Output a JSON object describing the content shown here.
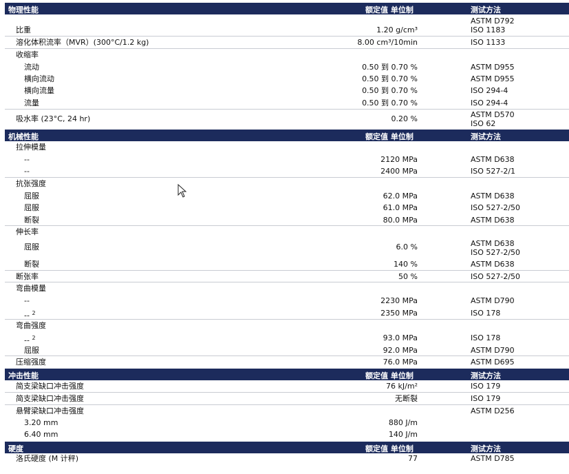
{
  "headers": {
    "value_unit": "额定值 单位制",
    "test_method": "测试方法"
  },
  "sections": [
    {
      "title": "物理性能",
      "rows": [
        {
          "label": "比重",
          "value": "1.20 g/cm³",
          "method": [
            "ASTM D792",
            "ISO 1183"
          ]
        },
        {
          "label": "溶化体积流率（MVR）(300°C/1.2 kg)",
          "value": "8.00 cm³/10min",
          "method": [
            "ISO 1133"
          ]
        },
        {
          "label": "收缩率",
          "value": "",
          "method": []
        },
        {
          "label": "流动",
          "value": "0.50 到 0.70 %",
          "method": [
            "ASTM D955"
          ]
        },
        {
          "label": "横向流动",
          "value": "0.50 到 0.70 %",
          "method": [
            "ASTM D955"
          ]
        },
        {
          "label": "横向流量",
          "value": "0.50 到 0.70 %",
          "method": [
            "ISO 294-4"
          ]
        },
        {
          "label": "流量",
          "value": "0.50 到 0.70 %",
          "method": [
            "ISO 294-4"
          ]
        },
        {
          "label": "吸水率 (23°C, 24 hr)",
          "value": "0.20 %",
          "method": [
            "ASTM D570",
            "ISO 62"
          ]
        }
      ]
    },
    {
      "title": "机械性能",
      "rows": [
        {
          "label": "拉伸模量",
          "value": "",
          "method": []
        },
        {
          "label": "--",
          "value": "2120 MPa",
          "method": [
            "ASTM D638"
          ]
        },
        {
          "label": "--",
          "value": "2400 MPa",
          "method": [
            "ISO 527-2/1"
          ]
        },
        {
          "label": "抗张强度",
          "value": "",
          "method": []
        },
        {
          "label": "屈服",
          "value": "62.0 MPa",
          "method": [
            "ASTM D638"
          ]
        },
        {
          "label": "屈服",
          "value": "61.0 MPa",
          "method": [
            "ISO 527-2/50"
          ]
        },
        {
          "label": "断裂",
          "value": "80.0 MPa",
          "method": [
            "ASTM D638"
          ]
        },
        {
          "label": "伸长率",
          "value": "",
          "method": []
        },
        {
          "label": "屈服",
          "value": "6.0 %",
          "method": [
            "ASTM D638",
            "ISO 527-2/50"
          ]
        },
        {
          "label": "断裂",
          "value": "140 %",
          "method": [
            "ASTM D638"
          ]
        },
        {
          "label": "断张率",
          "value": "50 %",
          "method": [
            "ISO 527-2/50"
          ]
        },
        {
          "label": "弯曲模量",
          "value": "",
          "method": []
        },
        {
          "label": "--",
          "value": "2230 MPa",
          "method": [
            "ASTM D790"
          ]
        },
        {
          "label": "--",
          "sup": "2",
          "value": "2350 MPa",
          "method": [
            "ISO 178"
          ]
        },
        {
          "label": "弯曲强度",
          "value": "",
          "method": []
        },
        {
          "label": "--",
          "sup": "2",
          "value": "93.0 MPa",
          "method": [
            "ISO 178"
          ]
        },
        {
          "label": "屈服",
          "value": "92.0 MPa",
          "method": [
            "ASTM D790"
          ]
        },
        {
          "label": "压缩强度",
          "value": "76.0 MPa",
          "method": [
            "ASTM D695"
          ]
        }
      ]
    },
    {
      "title": "冲击性能",
      "rows": [
        {
          "label": "简支梁缺口冲击强度",
          "value": "76 kJ/m²",
          "method": [
            "ISO 179"
          ]
        },
        {
          "label": "简支梁缺口冲击强度",
          "value": "无断裂",
          "method": [
            "ISO 179"
          ]
        },
        {
          "label": "悬臂梁缺口冲击强度",
          "value": "",
          "method": [
            "ASTM D256"
          ]
        },
        {
          "label": "3.20 mm",
          "value": "880 J/m",
          "method": []
        },
        {
          "label": "6.40 mm",
          "value": "140 J/m",
          "method": []
        }
      ]
    },
    {
      "title": "硬度",
      "rows": [
        {
          "label": "洛氏硬度 (M 计秤)",
          "value": "77",
          "method": [
            "ASTM D785"
          ]
        }
      ]
    }
  ]
}
